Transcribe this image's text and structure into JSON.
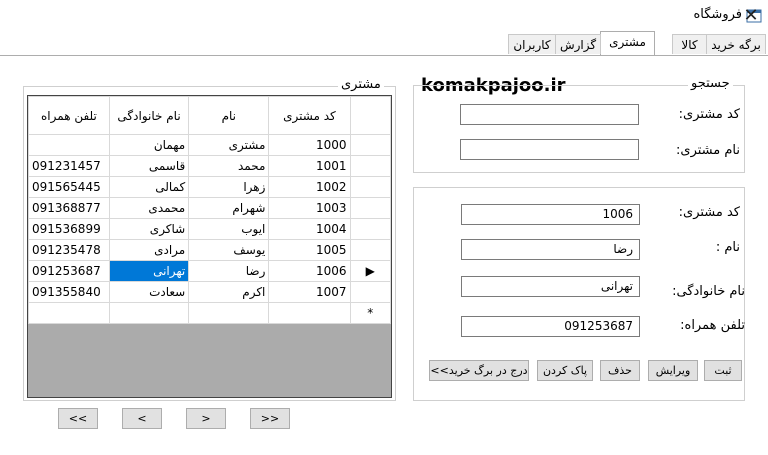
{
  "window": {
    "title": "فروشگاه",
    "close_glyph": "✕"
  },
  "tabs": [
    {
      "label": "برگه خرید"
    },
    {
      "label": "کالا"
    },
    {
      "label": "مشتری"
    },
    {
      "label": "گزارش"
    },
    {
      "label": "کاربران"
    }
  ],
  "active_tab": "مشتری",
  "watermark": "komakpajoo.ir",
  "customers_group": {
    "label": "مشتری"
  },
  "grid": {
    "headers": {
      "phone": "تلفن همراه",
      "family": "نام خانوادگی",
      "name": "نام",
      "code": "کد مشتری"
    },
    "rows": [
      {
        "phone": "",
        "family": "مهمان",
        "name": "مشتری",
        "code": "1000"
      },
      {
        "phone": "091231457",
        "family": "قاسمی",
        "name": "محمد",
        "code": "1001"
      },
      {
        "phone": "091565445",
        "family": "کمالی",
        "name": "زهرا",
        "code": "1002"
      },
      {
        "phone": "091368877",
        "family": "محمدی",
        "name": "شهرام",
        "code": "1003"
      },
      {
        "phone": "091536899",
        "family": "شاکری",
        "name": "ایوب",
        "code": "1004"
      },
      {
        "phone": "091235478",
        "family": "مرادی",
        "name": "یوسف",
        "code": "1005"
      },
      {
        "phone": "091253687",
        "family": "تهرانی",
        "name": "رضا",
        "code": "1006"
      },
      {
        "phone": "091355840",
        "family": "سعادت",
        "name": "اکرم",
        "code": "1007"
      }
    ],
    "current_row_marker": "▶",
    "new_row_marker": "*"
  },
  "nav_buttons": [
    ">>",
    ">",
    "<",
    "<<"
  ],
  "search": {
    "label": "جستجو",
    "code_label": "کد مشتری:",
    "name_label": "نام مشتری:",
    "code_value": "",
    "name_value": ""
  },
  "edit": {
    "code_label": "کد مشتری:",
    "code_value": "1006",
    "name_label": "نام :",
    "name_value": "رضا",
    "family_label": "نام خانوادگی:",
    "family_value": "تهرانی",
    "phone_label": "تلفن همراه:",
    "phone_value": "091253687"
  },
  "actions": {
    "save": "ثبت",
    "edit": "ویرایش",
    "delete": "حذف",
    "clear": "پاک کردن",
    "insert": "درج در برگ خرید>>"
  }
}
